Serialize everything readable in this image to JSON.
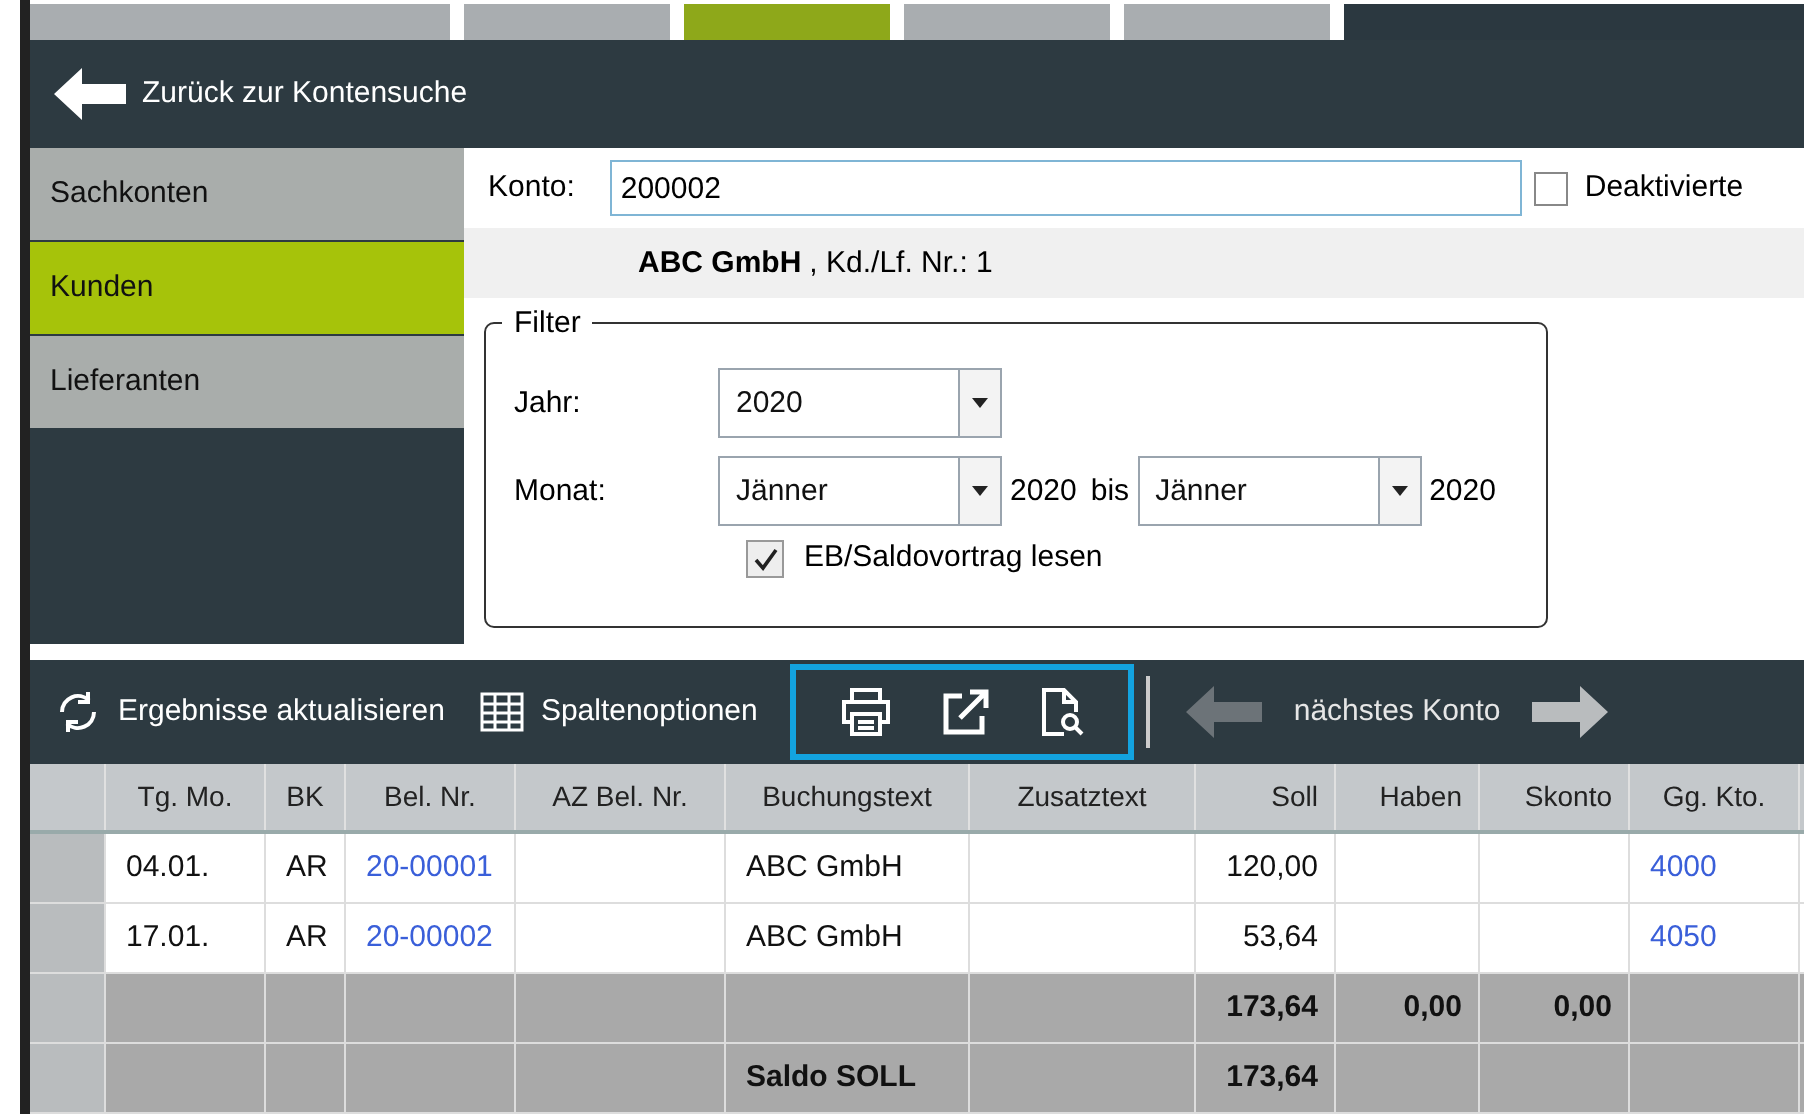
{
  "top_tabs": [
    {
      "selected": false
    },
    {
      "selected": false
    },
    {
      "selected": true
    },
    {
      "selected": false
    },
    {
      "selected": false
    }
  ],
  "header": {
    "back_label": "Zurück zur Kontensuche"
  },
  "sidebar": {
    "items": [
      {
        "label": "Sachkonten",
        "selected": false
      },
      {
        "label": "Kunden",
        "selected": true
      },
      {
        "label": "Lieferanten",
        "selected": false
      }
    ]
  },
  "account": {
    "label": "Konto:",
    "value": "200002",
    "deactivated": {
      "label": "Deaktivierte",
      "checked": false
    },
    "name": "ABC GmbH",
    "suffix": ", Kd./Lf. Nr.: 1"
  },
  "filter": {
    "title": "Filter",
    "year_label": "Jahr:",
    "year": "2020",
    "month_label": "Monat:",
    "month_from": "Jänner",
    "year_from": "2020",
    "to_label": "bis",
    "month_to": "Jänner",
    "year_to": "2020",
    "opening": {
      "label": "EB/Saldovortrag lesen",
      "checked": true
    }
  },
  "toolbar": {
    "refresh": "Ergebnisse aktualisieren",
    "columns": "Spaltenoptionen",
    "next": "nächstes Konto"
  },
  "table": {
    "columns": [
      {
        "label": "Tg. Mo.",
        "kind": "text"
      },
      {
        "label": "BK",
        "kind": "text"
      },
      {
        "label": "Bel. Nr.",
        "kind": "link"
      },
      {
        "label": "AZ Bel. Nr.",
        "kind": "text"
      },
      {
        "label": "Buchungstext",
        "kind": "text"
      },
      {
        "label": "Zusatztext",
        "kind": "text"
      },
      {
        "label": "Soll",
        "kind": "amount"
      },
      {
        "label": "Haben",
        "kind": "amount"
      },
      {
        "label": "Skonto",
        "kind": "amount"
      },
      {
        "label": "Gg. Kto.",
        "kind": "link"
      }
    ],
    "rows": [
      {
        "kind": "entry",
        "cells": [
          "04.01.",
          "AR",
          "20-00001",
          "",
          "ABC GmbH",
          "",
          "120,00",
          "",
          "",
          "4000"
        ]
      },
      {
        "kind": "entry",
        "cells": [
          "17.01.",
          "AR",
          "20-00002",
          "",
          "ABC GmbH",
          "",
          "53,64",
          "",
          "",
          "4050"
        ]
      },
      {
        "kind": "total",
        "cells": [
          "",
          "",
          "",
          "",
          "",
          "",
          "173,64",
          "0,00",
          "0,00",
          ""
        ]
      },
      {
        "kind": "total",
        "cells": [
          "",
          "",
          "",
          "",
          "Saldo SOLL",
          "",
          "173,64",
          "",
          "",
          ""
        ]
      }
    ]
  }
}
